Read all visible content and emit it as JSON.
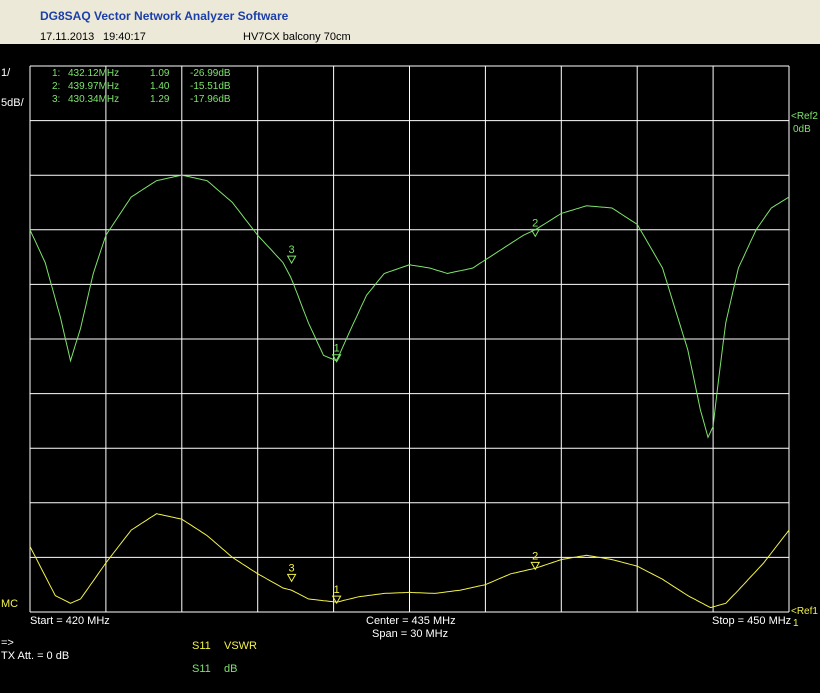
{
  "app_title": "DG8SAQ Vector Network Analyzer Software",
  "header": {
    "date": "17.11.2013",
    "time": "19:40:17",
    "measurement": "HV7CX balcony 70cm"
  },
  "scale_left": {
    "line1": "1/",
    "line2": "5dB/"
  },
  "markers": [
    {
      "label": "1:",
      "freq": "432.12MHz",
      "vswr": "1.09",
      "db": "-26.99dB"
    },
    {
      "label": "2:",
      "freq": "439.97MHz",
      "vswr": "1.40",
      "db": "-15.51dB"
    },
    {
      "label": "3:",
      "freq": "430.34MHz",
      "vswr": "1.29",
      "db": "-17.96dB"
    }
  ],
  "ref2": {
    "line1": "<Ref2",
    "line2": "0dB"
  },
  "ref1": {
    "line1": "<Ref1",
    "line2": "1"
  },
  "mc_label": "MC",
  "freq_axis": {
    "start": "Start = 420 MHz",
    "center": "Center = 435 MHz",
    "span": "Span = 30 MHz",
    "stop": "Stop = 450 MHz"
  },
  "bottom": {
    "arrow": "=>",
    "tx_att": "TX Att.  = 0 dB",
    "traces": [
      {
        "param": "S11",
        "format": "VSWR"
      },
      {
        "param": "S11",
        "format": "dB"
      }
    ]
  },
  "colors": {
    "db_trace": "#7de36b",
    "vswr_trace": "#f2f24a",
    "grid": "#ffffff",
    "background": "#000000",
    "title": "#1c3fa8"
  },
  "chart_data": {
    "type": "line",
    "title": "",
    "xlim": [
      420,
      450
    ],
    "x_unit": "MHz",
    "series": [
      {
        "name": "S11 dB",
        "ylim": [
          -50,
          0
        ],
        "x": [
          420,
          420.6,
          421.2,
          421.6,
          422,
          422.5,
          423,
          424,
          425,
          426,
          427,
          428,
          429,
          430,
          430.34,
          431,
          431.6,
          432.12,
          432.6,
          433.3,
          434,
          435,
          435.8,
          436.5,
          437.5,
          438.5,
          439.5,
          439.97,
          441,
          442,
          443,
          444,
          445,
          446,
          446.5,
          446.8,
          447,
          447.2,
          447.5,
          448,
          448.7,
          449.3,
          450
        ],
        "values": [
          -15,
          -18,
          -23,
          -27,
          -24,
          -19,
          -15.5,
          -12,
          -10.5,
          -10,
          -10.5,
          -12.5,
          -15.5,
          -18,
          -19.5,
          -23.5,
          -26.5,
          -27,
          -24.5,
          -21,
          -19,
          -18.2,
          -18.5,
          -19,
          -18.5,
          -17,
          -15.5,
          -15,
          -13.5,
          -12.8,
          -13,
          -14.5,
          -18.5,
          -26,
          -31.5,
          -34,
          -33,
          -29,
          -23.5,
          -18.5,
          -15,
          -13,
          -12
        ]
      },
      {
        "name": "S11 VSWR",
        "ylim": [
          1,
          6
        ],
        "x": [
          420,
          421,
          421.6,
          422,
          423,
          424,
          425,
          426,
          427,
          428,
          429,
          430,
          430.34,
          431,
          432.12,
          433,
          434,
          435,
          436,
          437,
          438,
          439,
          439.97,
          441,
          442,
          443,
          444,
          445,
          446,
          446.9,
          447.5,
          448,
          449,
          450
        ],
        "values": [
          1.6,
          1.15,
          1.08,
          1.12,
          1.45,
          1.75,
          1.9,
          1.85,
          1.7,
          1.5,
          1.35,
          1.22,
          1.2,
          1.12,
          1.09,
          1.14,
          1.17,
          1.18,
          1.17,
          1.2,
          1.25,
          1.35,
          1.4,
          1.48,
          1.52,
          1.48,
          1.42,
          1.3,
          1.15,
          1.04,
          1.08,
          1.2,
          1.45,
          1.75
        ]
      }
    ],
    "markers": [
      {
        "id": "1",
        "freq": 432.12,
        "db": -26.99,
        "vswr": 1.09
      },
      {
        "id": "2",
        "freq": 439.97,
        "db": -15.51,
        "vswr": 1.4
      },
      {
        "id": "3",
        "freq": 430.34,
        "db": -17.96,
        "vswr": 1.29
      }
    ],
    "grid": true,
    "divisions": {
      "x": 10,
      "y": 10
    }
  }
}
